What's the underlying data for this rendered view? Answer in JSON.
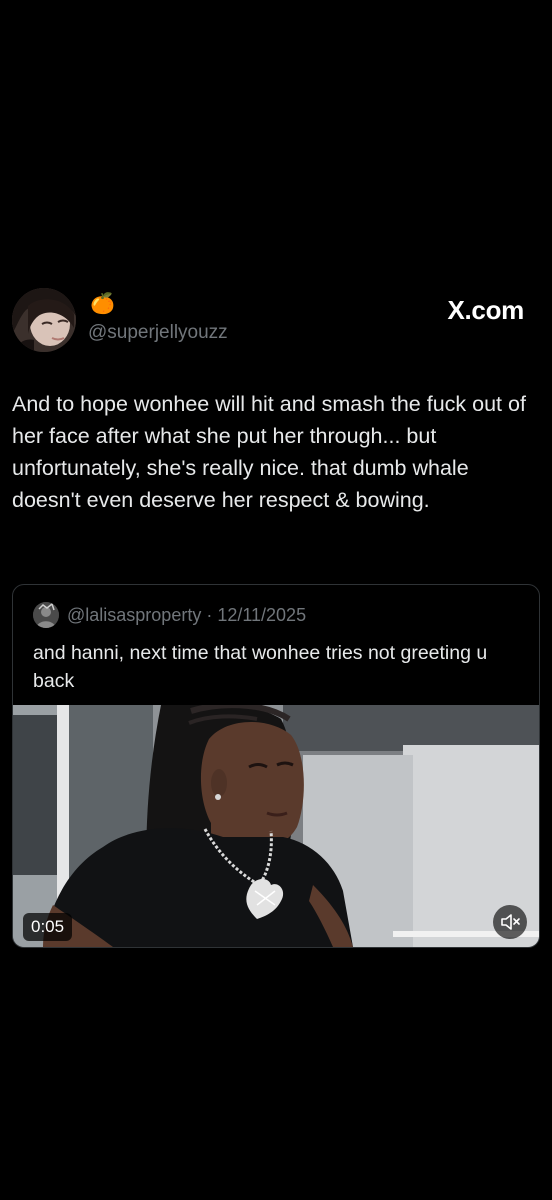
{
  "post": {
    "author_emoji": "🍊",
    "handle": "@superjellyouzz",
    "platform_label": "X.com",
    "text": "And to hope wonhee will hit and smash the fuck out of her face after what she put her through... but unfortunately, she's really nice. that dumb whale doesn't even deserve her respect & bowing."
  },
  "quoted_post": {
    "handle": "@lalisasproperty",
    "separator": " · ",
    "date": "12/11/2025",
    "text": "and hanni, next time that wonhee tries not greeting u back",
    "video": {
      "duration": "0:05",
      "muted": true,
      "mute_icon": "speaker-muted-icon"
    }
  },
  "colors": {
    "background": "#000000",
    "text_primary": "#e7e9ea",
    "text_secondary": "#71767b",
    "card_border": "#2f3336"
  }
}
